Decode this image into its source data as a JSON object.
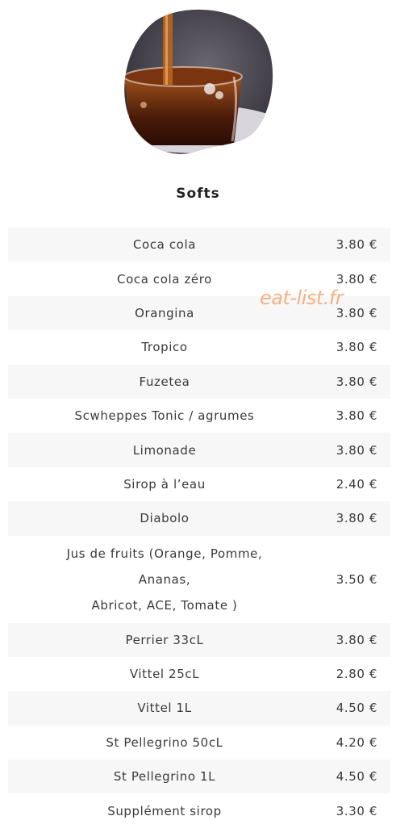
{
  "section": {
    "title": "Softs"
  },
  "watermark": "eat-list.fr",
  "items": [
    {
      "name": "Coca cola",
      "price": "3.80 €"
    },
    {
      "name": "Coca cola zéro",
      "price": "3.80 €"
    },
    {
      "name": "Orangina",
      "price": "3.80 €"
    },
    {
      "name": "Tropico",
      "price": "3.80 €"
    },
    {
      "name": "Fuzetea",
      "price": "3.80 €"
    },
    {
      "name": "Scwheppes Tonic / agrumes",
      "price": "3.80 €"
    },
    {
      "name": "Limonade",
      "price": "3.80 €"
    },
    {
      "name": "Sirop à l’eau",
      "price": "2.40 €"
    },
    {
      "name": "Diabolo",
      "price": "3.80 €"
    },
    {
      "name_lines": [
        "Jus de fruits (Orange, Pomme,",
        "Ananas,",
        "Abricot, ACE, Tomate )"
      ],
      "price": "3.50 €"
    },
    {
      "name": "Perrier 33cL",
      "price": "3.80 €"
    },
    {
      "name": "Vittel 25cL",
      "price": "2.80 €"
    },
    {
      "name": "Vittel 1L",
      "price": "4.50 €"
    },
    {
      "name": "St Pellegrino 50cL",
      "price": "4.20 €"
    },
    {
      "name": "St Pellegrino 1L",
      "price": "4.50 €"
    },
    {
      "name": "Supplément sirop",
      "price": "3.30 €"
    }
  ]
}
